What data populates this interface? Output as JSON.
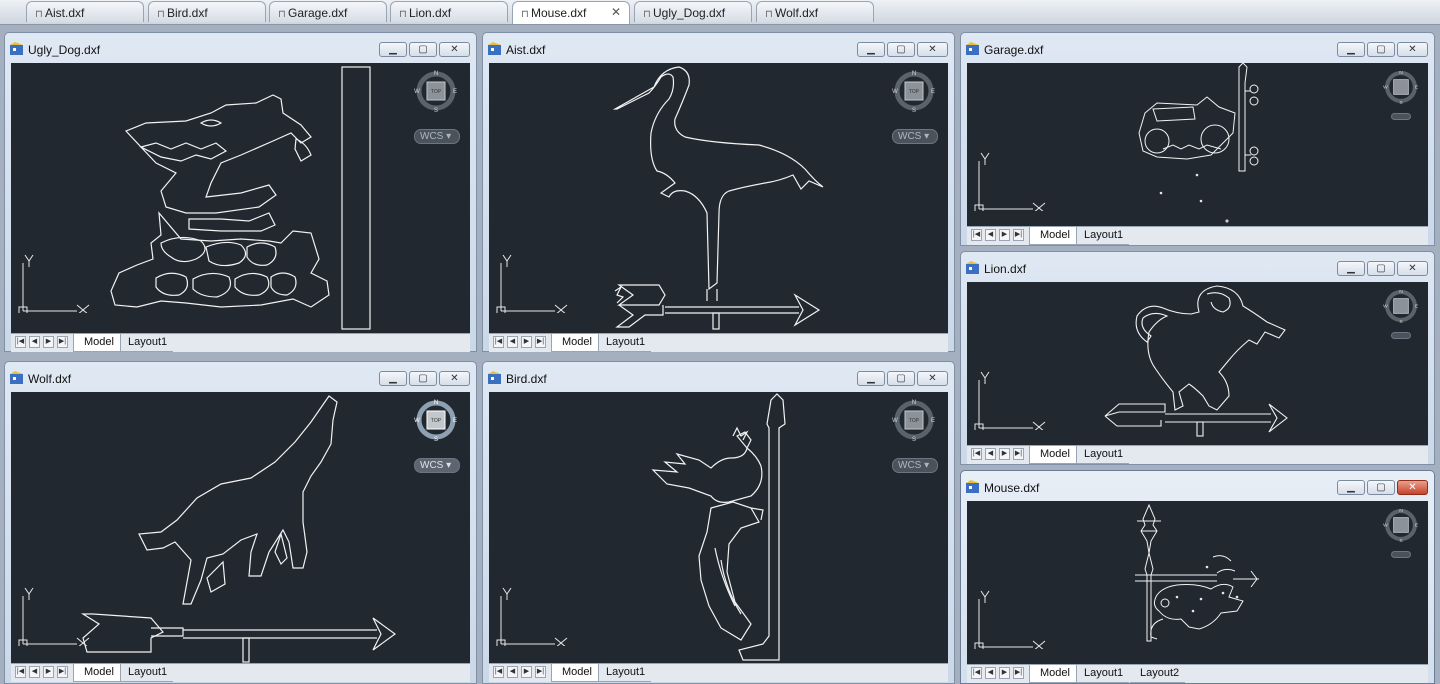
{
  "tabs": [
    {
      "label": "Aist.dxf",
      "active": false
    },
    {
      "label": "Bird.dxf",
      "active": false
    },
    {
      "label": "Garage.dxf",
      "active": false
    },
    {
      "label": "Lion.dxf",
      "active": false
    },
    {
      "label": "Mouse.dxf",
      "active": true
    },
    {
      "label": "Ugly_Dog.dxf",
      "active": false
    },
    {
      "label": "Wolf.dxf",
      "active": false
    }
  ],
  "windows": {
    "ugly_dog": {
      "title": "Ugly_Dog.dxf",
      "layouts": [
        "Model",
        "Layout1"
      ]
    },
    "aist": {
      "title": "Aist.dxf",
      "layouts": [
        "Model",
        "Layout1"
      ]
    },
    "garage": {
      "title": "Garage.dxf",
      "layouts": [
        "Model",
        "Layout1"
      ]
    },
    "lion": {
      "title": "Lion.dxf",
      "layouts": [
        "Model",
        "Layout1"
      ]
    },
    "wolf": {
      "title": "Wolf.dxf",
      "layouts": [
        "Model",
        "Layout1"
      ]
    },
    "bird": {
      "title": "Bird.dxf",
      "layouts": [
        "Model",
        "Layout1"
      ]
    },
    "mouse": {
      "title": "Mouse.dxf",
      "layouts": [
        "Model",
        "Layout1",
        "Layout2"
      ]
    }
  },
  "viewcube": {
    "top_label": "TOP",
    "n": "N",
    "s": "S",
    "e": "E",
    "w": "W",
    "wcs_label": "WCS"
  },
  "ucs": {
    "y_label": "Y"
  },
  "colors": {
    "viewport_bg": "#212830",
    "drawing_stroke": "#f2f2f2",
    "active_close": "#c7432a"
  }
}
